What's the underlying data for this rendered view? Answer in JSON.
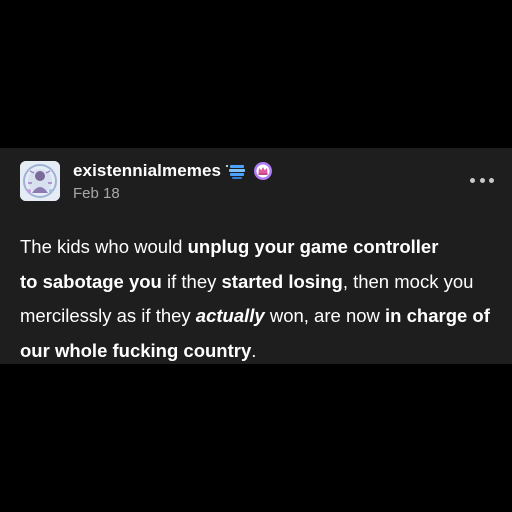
{
  "post": {
    "blog_name": "existennialmemes",
    "date": "Feb 18",
    "icons": {
      "avatar": "avatar-image",
      "badge_1": "gift-stack-badge-icon",
      "badge_2": "crown-badge-icon",
      "more": "more-options-icon"
    },
    "colors": {
      "card_background": "#1e1e1e",
      "page_background": "#000000",
      "text": "#ffffff",
      "secondary_text": "#a8a8a8",
      "badge_blue": "#4aa3ff",
      "badge_purple": "#b07cf5"
    },
    "body": {
      "t1": "The kids who would ",
      "b1": "unplug your game controller",
      "t2": " ",
      "b2": "to sabotage you",
      "t3": " if they ",
      "b3": "started losing",
      "t4": ", then mock you mercilessly as if they ",
      "i1": "actually",
      "t5": " won, are now ",
      "b4": "in charge of our whole fucking country",
      "t6": "."
    }
  }
}
